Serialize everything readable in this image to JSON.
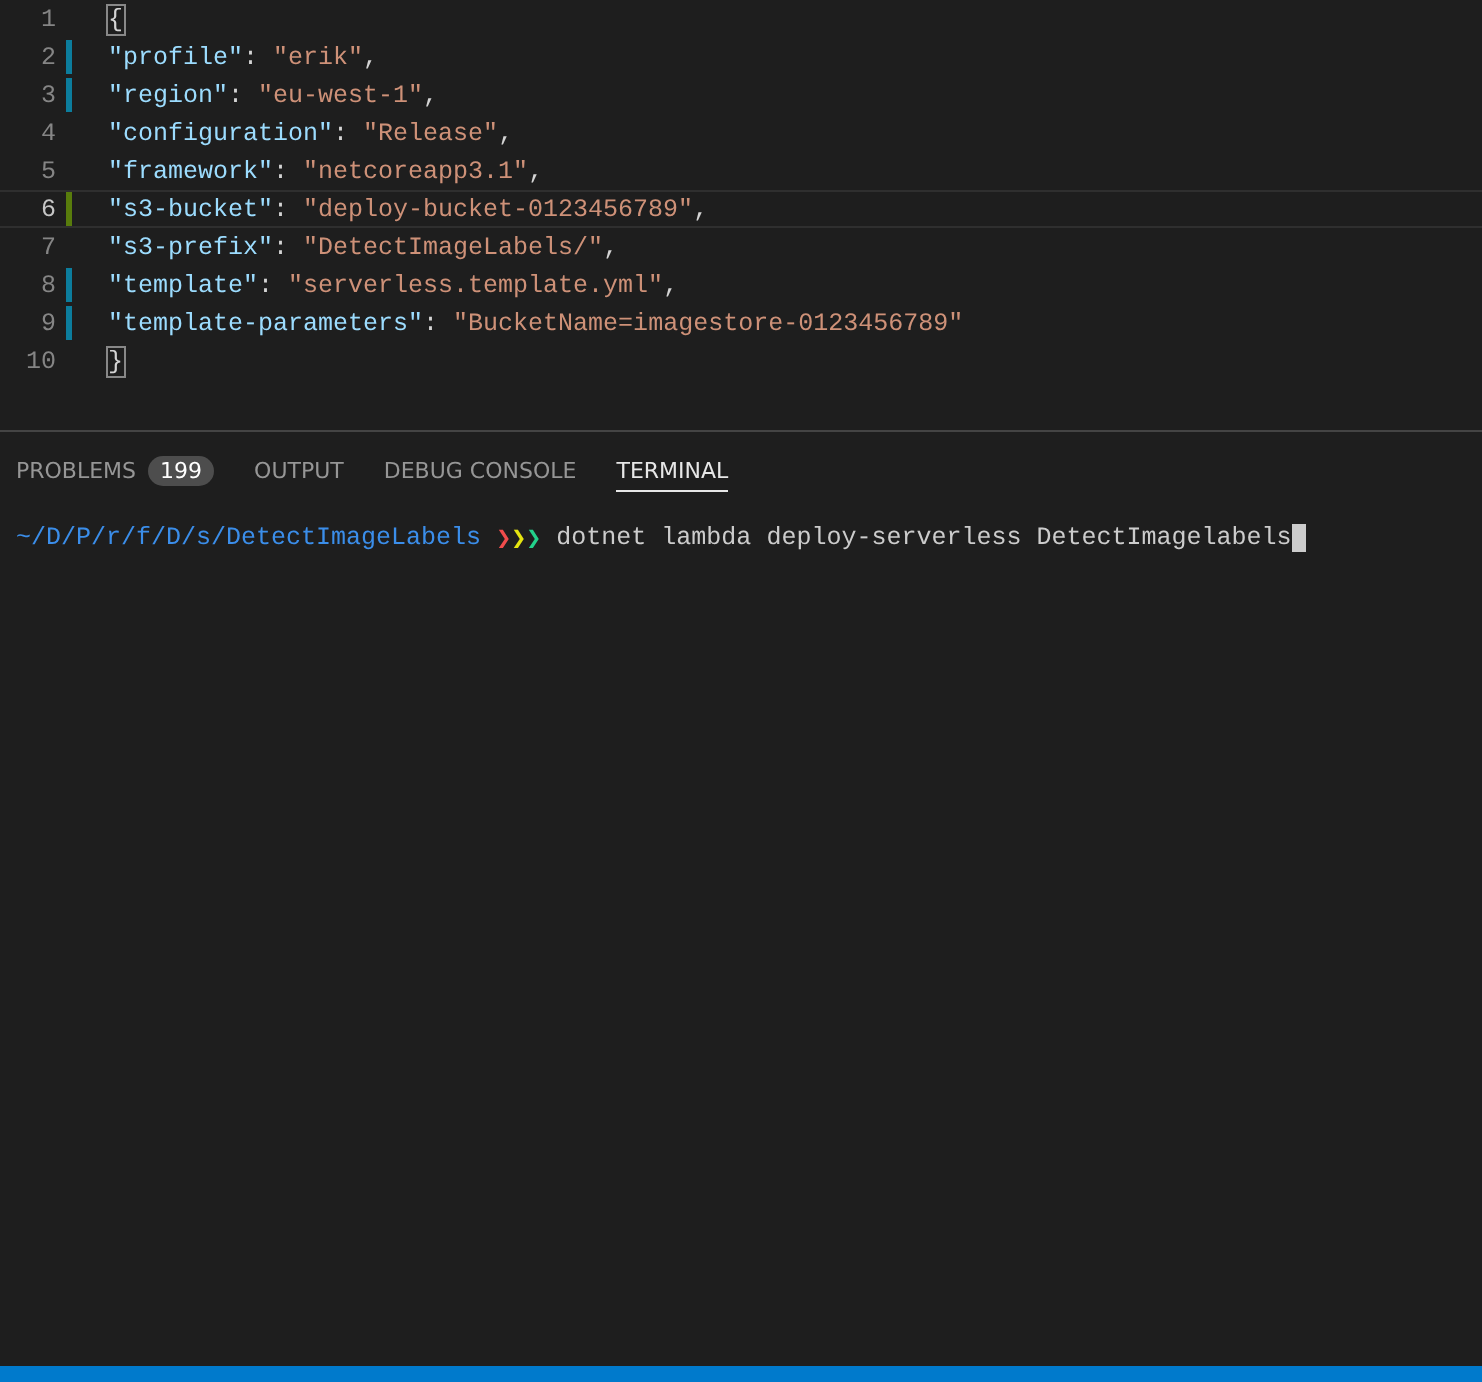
{
  "editor": {
    "lines": [
      {
        "number": "1",
        "modified": false,
        "added": false,
        "current": false,
        "tokens": [
          {
            "kind": "bracket",
            "text": "{"
          }
        ]
      },
      {
        "number": "2",
        "modified": true,
        "added": false,
        "current": false,
        "tokens": [
          {
            "kind": "key",
            "text": "\"profile\""
          },
          {
            "kind": "punct",
            "text": ": "
          },
          {
            "kind": "string",
            "text": "\"erik\""
          },
          {
            "kind": "punct",
            "text": ","
          }
        ]
      },
      {
        "number": "3",
        "modified": true,
        "added": false,
        "current": false,
        "tokens": [
          {
            "kind": "key",
            "text": "\"region\""
          },
          {
            "kind": "punct",
            "text": ": "
          },
          {
            "kind": "string",
            "text": "\"eu-west-1\""
          },
          {
            "kind": "punct",
            "text": ","
          }
        ]
      },
      {
        "number": "4",
        "modified": false,
        "added": false,
        "current": false,
        "tokens": [
          {
            "kind": "key",
            "text": "\"configuration\""
          },
          {
            "kind": "punct",
            "text": ": "
          },
          {
            "kind": "string",
            "text": "\"Release\""
          },
          {
            "kind": "punct",
            "text": ","
          }
        ]
      },
      {
        "number": "5",
        "modified": false,
        "added": false,
        "current": false,
        "tokens": [
          {
            "kind": "key",
            "text": "\"framework\""
          },
          {
            "kind": "punct",
            "text": ": "
          },
          {
            "kind": "string",
            "text": "\"netcoreapp3.1\""
          },
          {
            "kind": "punct",
            "text": ","
          }
        ]
      },
      {
        "number": "6",
        "modified": false,
        "added": true,
        "current": true,
        "tokens": [
          {
            "kind": "key",
            "text": "\"s3-bucket\""
          },
          {
            "kind": "punct",
            "text": ": "
          },
          {
            "kind": "string",
            "text": "\"deploy-bucket-0123456789\""
          },
          {
            "kind": "punct",
            "text": ","
          }
        ]
      },
      {
        "number": "7",
        "modified": false,
        "added": false,
        "current": false,
        "tokens": [
          {
            "kind": "key",
            "text": "\"s3-prefix\""
          },
          {
            "kind": "punct",
            "text": ": "
          },
          {
            "kind": "string",
            "text": "\"DetectImageLabels/\""
          },
          {
            "kind": "punct",
            "text": ","
          }
        ]
      },
      {
        "number": "8",
        "modified": true,
        "added": false,
        "current": false,
        "tokens": [
          {
            "kind": "key",
            "text": "\"template\""
          },
          {
            "kind": "punct",
            "text": ": "
          },
          {
            "kind": "string",
            "text": "\"serverless.template.yml\""
          },
          {
            "kind": "punct",
            "text": ","
          }
        ]
      },
      {
        "number": "9",
        "modified": true,
        "added": false,
        "current": false,
        "tokens": [
          {
            "kind": "key",
            "text": "\"template-parameters\""
          },
          {
            "kind": "punct",
            "text": ": "
          },
          {
            "kind": "string",
            "text": "\"BucketName=imagestore-0123456789\""
          }
        ]
      },
      {
        "number": "10",
        "modified": false,
        "added": false,
        "current": false,
        "tokens": [
          {
            "kind": "bracket",
            "text": "}"
          }
        ]
      }
    ]
  },
  "panel": {
    "tabs": [
      {
        "label": "PROBLEMS",
        "badge": "199",
        "selected": false
      },
      {
        "label": "OUTPUT",
        "selected": false
      },
      {
        "label": "DEBUG CONSOLE",
        "selected": false
      },
      {
        "label": "TERMINAL",
        "selected": true
      }
    ],
    "terminal": {
      "path": "~/D/P/r/f/D/s/DetectImageLabels",
      "prompt": [
        {
          "text": "❯",
          "color": "#f14c4c"
        },
        {
          "text": "❯",
          "color": "#e5e510"
        },
        {
          "text": "❯",
          "color": "#23d18b"
        }
      ],
      "command": "dotnet lambda deploy-serverless DetectImagelabels"
    }
  }
}
